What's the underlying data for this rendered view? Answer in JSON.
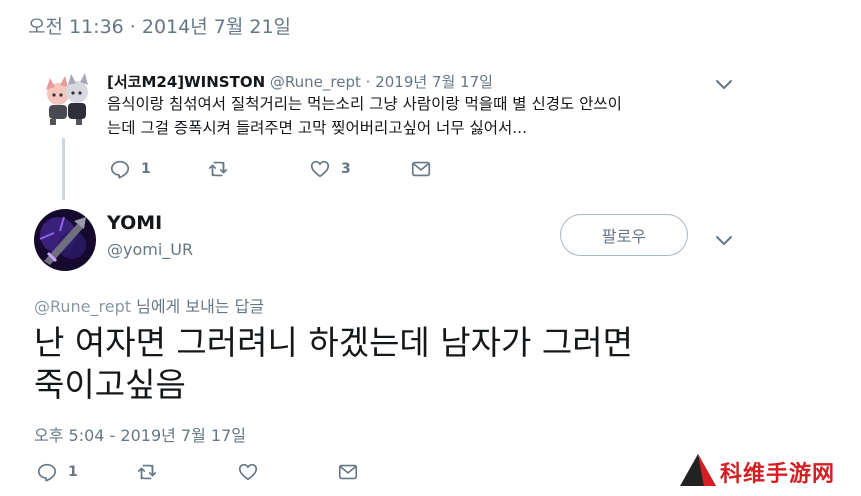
{
  "top_date": "오전 11:36 · 2014년 7월 21일",
  "parent_tweet": {
    "name": "[서코M24]WINSTON",
    "handle": "@Rune_rept",
    "date": "· 2019년 7월 17일",
    "text_line1": "음식이랑 침섞여서 질척거리는 먹는소리 그냥 사람이랑 먹을때 별 신경도 안쓰이",
    "text_line2": "는데 그걸 증폭시켜 들려주면 고막 찢어버리고싶어 너무 싫어서...",
    "reply_count": "1",
    "like_count": "3"
  },
  "main_tweet": {
    "name": "YOMI",
    "handle": "@yomi_UR",
    "follow_label": "팔로우",
    "reply_to_handle": "@Rune_rept",
    "reply_to_suffix": " 님에게 보내는 답글",
    "text_line1": "난 여자면 그러려니 하겠는데 남자가 그러면",
    "text_line2": "죽이고싶음",
    "date": "오후 5:04 - 2019년 7월 17일",
    "reply_count": "1"
  },
  "watermark": "科维手游网",
  "icons": {
    "reply": "reply-icon",
    "retweet": "retweet-icon",
    "like": "heart-icon",
    "message": "message-icon",
    "more": "chevron-down-icon"
  },
  "colors": {
    "text": "#14171a",
    "muted": "#657786",
    "border": "#aab8c2",
    "thread_line": "#ccd6dd",
    "watermark_red": "#d42025"
  }
}
